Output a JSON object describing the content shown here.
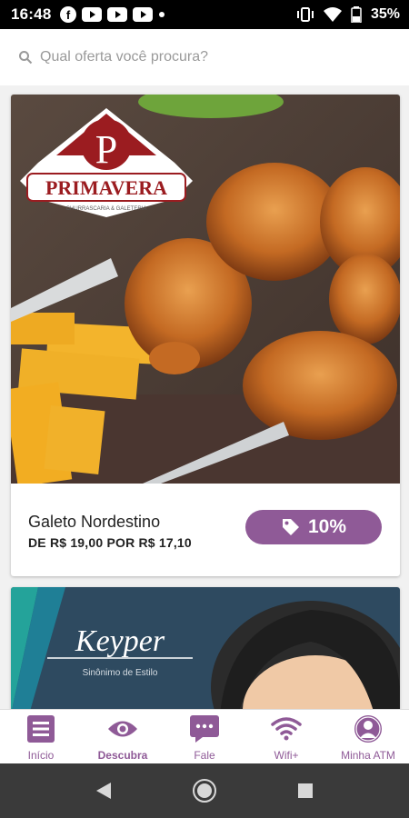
{
  "status_bar": {
    "time": "16:48",
    "battery_text": "35%",
    "left_icons": [
      "facebook-icon",
      "youtube-icon",
      "youtube-icon",
      "youtube-icon",
      "dot-icon"
    ],
    "right_icons": [
      "vibrate-icon",
      "wifi-icon",
      "battery-icon"
    ]
  },
  "search": {
    "placeholder": "Qual oferta você procura?",
    "icon": "search-icon"
  },
  "offers": [
    {
      "brand_logo_text": "PRIMAVERA",
      "brand_logo_subtext": "CHURRASCARIA & GALETERIA",
      "title": "Galeto Nordestino",
      "price": "DE R$ 19,00 POR R$ 17,10",
      "discount": "10%",
      "discount_icon": "tag-icon"
    },
    {
      "brand_logo_text": "Keyper",
      "brand_logo_subtext": "Sinônimo de Estilo"
    }
  ],
  "bottom_nav": [
    {
      "label": "Início",
      "icon": "home-list-icon"
    },
    {
      "label": "Descubra",
      "icon": "eye-icon",
      "active": true
    },
    {
      "label": "Fale",
      "icon": "chat-icon"
    },
    {
      "label": "Wifi+",
      "icon": "wifi-icon"
    },
    {
      "label": "Minha ATM",
      "icon": "user-icon"
    }
  ],
  "colors": {
    "accent": "#8f5a97",
    "status_bar": "#000000",
    "system_nav": "#3a3a3a",
    "logo_red": "#9b1c20"
  }
}
